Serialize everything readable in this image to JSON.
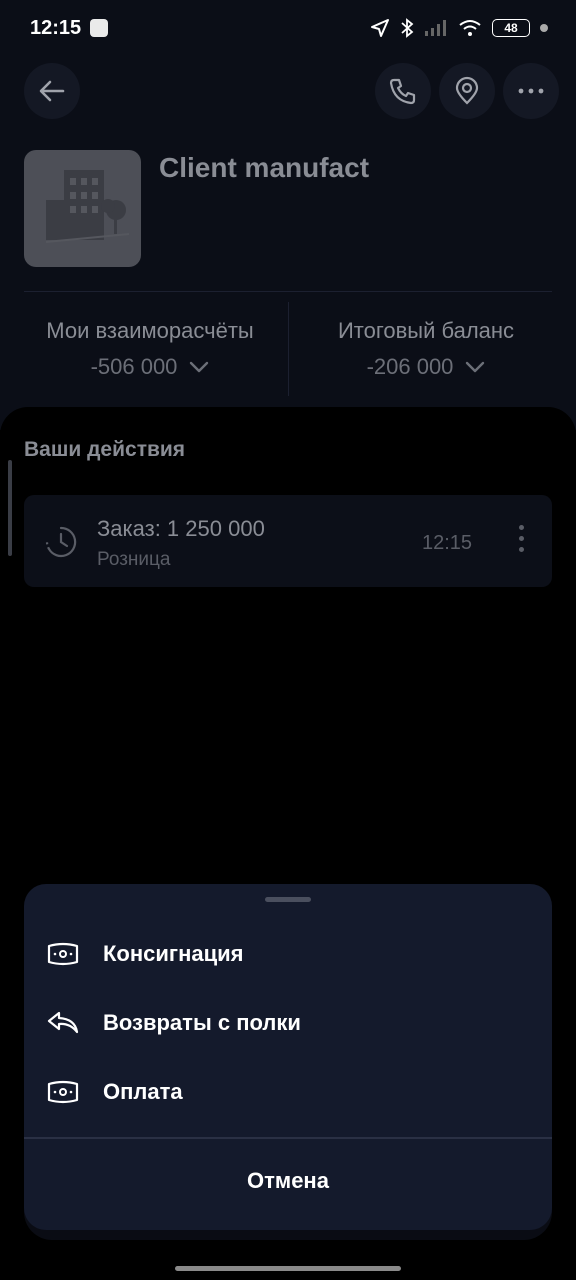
{
  "status_bar": {
    "time": "12:15",
    "battery": "48"
  },
  "client": {
    "name": "Client manufact"
  },
  "balances": {
    "mutual": {
      "label": "Мои взаиморасчёты",
      "value": "-506 000"
    },
    "total": {
      "label": "Итоговый баланс",
      "value": "-206 000"
    }
  },
  "actions": {
    "title": "Ваши действия",
    "items": [
      {
        "title": "Заказ: 1 250 000",
        "subtitle": "Розница",
        "time": "12:15"
      }
    ]
  },
  "menu": {
    "items": [
      {
        "label": "Консигнация",
        "icon": "money-icon"
      },
      {
        "label": "Возвраты с полки",
        "icon": "return-icon"
      },
      {
        "label": "Оплата",
        "icon": "money-icon"
      }
    ],
    "cancel": "Отмена"
  }
}
